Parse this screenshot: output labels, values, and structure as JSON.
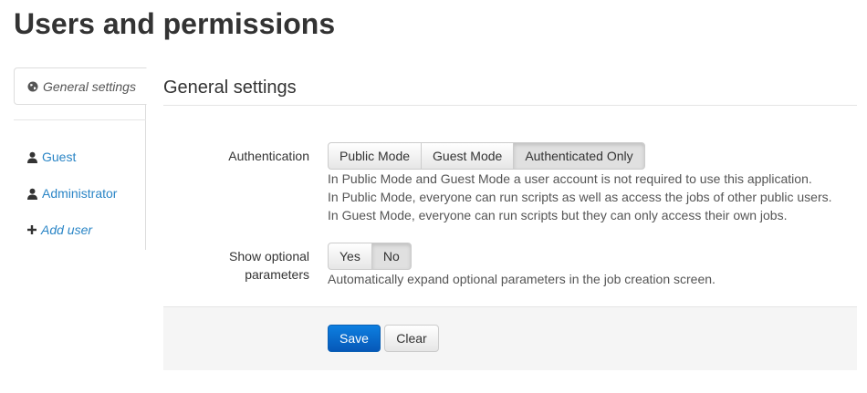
{
  "page": {
    "title": "Users and permissions"
  },
  "sidebar": {
    "active_tab": {
      "label": "General settings",
      "icon": "globe-icon"
    },
    "items": [
      {
        "label": "Guest",
        "icon": "user-icon"
      },
      {
        "label": "Administrator",
        "icon": "user-icon"
      },
      {
        "label": "Add user",
        "icon": "plus-icon"
      }
    ]
  },
  "main": {
    "section_title": "General settings",
    "authentication": {
      "label": "Authentication",
      "options": [
        "Public Mode",
        "Guest Mode",
        "Authenticated Only"
      ],
      "selected": "Authenticated Only",
      "help": [
        "In Public Mode and Guest Mode a user account is not required to use this application.",
        "In Public Mode, everyone can run scripts as well as access the jobs of other public users.",
        "In Guest Mode, everyone can run scripts but they can only access their own jobs."
      ]
    },
    "optional_params": {
      "label_line1": "Show optional",
      "label_line2": "parameters",
      "options": [
        "Yes",
        "No"
      ],
      "selected": "No",
      "help": "Automatically expand optional parameters in the job creation screen."
    },
    "actions": {
      "save": "Save",
      "clear": "Clear"
    }
  },
  "colors": {
    "link": "#2a85c6",
    "primary": "#0a6ad0"
  }
}
